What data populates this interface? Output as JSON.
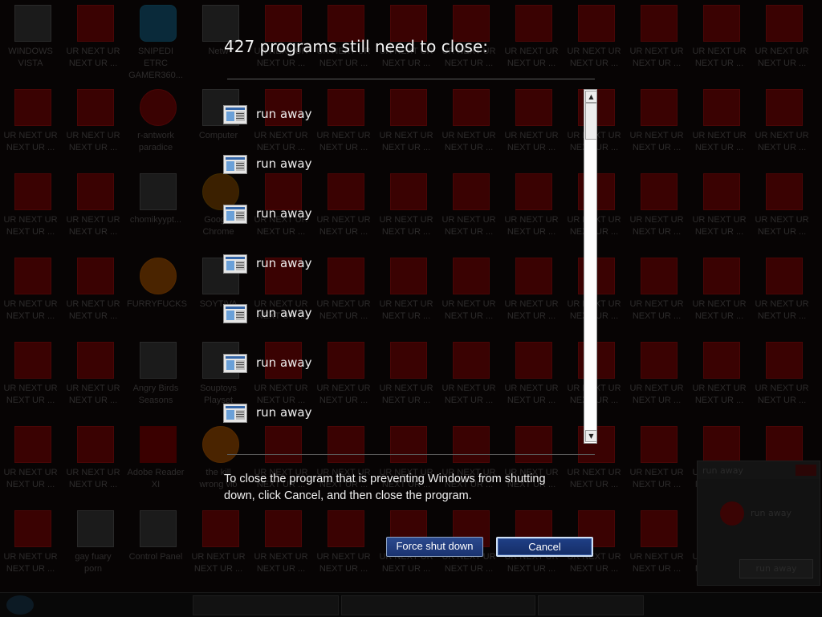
{
  "desktop": {
    "icons": [
      {
        "label": "WINDOWS\nVISTA",
        "style": "dark"
      },
      {
        "label": "UR NEXT UR\nNEXT UR ...",
        "style": "red"
      },
      {
        "label": "SNIPEDI ETRC\nGAMER360...",
        "style": "blue"
      },
      {
        "label": "Netw",
        "style": "dark"
      },
      {
        "label": "UR NEXT UR\nNEXT UR ...",
        "style": "red"
      },
      {
        "label": "r-antwork\nparadice",
        "style": "round"
      },
      {
        "label": "Computer",
        "style": "dark"
      },
      {
        "label": "chomikyypt...",
        "style": "dark"
      },
      {
        "label": "Google\nChrome",
        "style": "chrome"
      },
      {
        "label": "FURRYFUCKS",
        "style": "orange"
      },
      {
        "label": "SOYTIVA",
        "style": "dark"
      },
      {
        "label": "Angry Birds\nSeasons",
        "style": "dark"
      },
      {
        "label": "Souptoys\nPlayset",
        "style": "dark"
      },
      {
        "label": "Adobe Reader\nXI",
        "style": "adobe"
      },
      {
        "label": "the kill\nwrong vio",
        "style": "orange"
      },
      {
        "label": "gay fuary\nporn",
        "style": "dark"
      },
      {
        "label": "Control Panel",
        "style": "dark"
      }
    ],
    "repeat_label": "UR NEXT UR\nNEXT UR ..."
  },
  "background_popup": {
    "title": "run away",
    "message": "run away",
    "button": "run away"
  },
  "taskbar": {
    "clock": ""
  },
  "shutdown": {
    "heading": "427 programs still need to close:",
    "programs": [
      {
        "label": "run away",
        "icon": "program-window-icon"
      },
      {
        "label": "run away",
        "icon": "program-window-icon"
      },
      {
        "label": "run away",
        "icon": "program-window-icon"
      },
      {
        "label": "run away",
        "icon": "program-window-icon"
      },
      {
        "label": "run away",
        "icon": "program-window-icon"
      },
      {
        "label": "run away",
        "icon": "program-window-icon"
      },
      {
        "label": "run away",
        "icon": "program-window-icon"
      }
    ],
    "instructions": "To close the program that is preventing Windows from shutting down, click Cancel, and then close the program.",
    "force_label": "Force shut down",
    "cancel_label": "Cancel"
  }
}
